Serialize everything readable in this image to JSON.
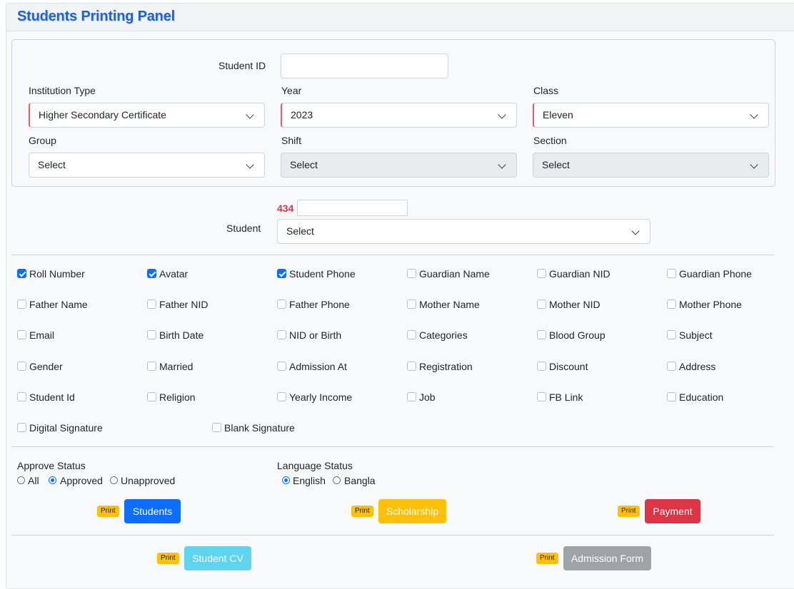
{
  "header": {
    "title": "Students Printing Panel"
  },
  "filters": {
    "student_id": {
      "label": "Student ID",
      "value": ""
    },
    "institution_type": {
      "label": "Institution Type",
      "value": "Higher Secondary Certificate"
    },
    "year": {
      "label": "Year",
      "value": "2023"
    },
    "class": {
      "label": "Class",
      "value": "Eleven"
    },
    "group": {
      "label": "Group",
      "value": "Select"
    },
    "shift": {
      "label": "Shift",
      "value": "Select"
    },
    "section": {
      "label": "Section",
      "value": "Select"
    }
  },
  "student": {
    "label": "Student",
    "count": "434",
    "search_value": "",
    "value": "Select"
  },
  "fields": [
    {
      "label": "Roll Number",
      "checked": true
    },
    {
      "label": "Avatar",
      "checked": true
    },
    {
      "label": "Student Phone",
      "checked": true
    },
    {
      "label": "Guardian Name",
      "checked": false
    },
    {
      "label": "Guardian NID",
      "checked": false
    },
    {
      "label": "Guardian Phone",
      "checked": false
    },
    {
      "label": "Father Name",
      "checked": false
    },
    {
      "label": "Father NID",
      "checked": false
    },
    {
      "label": "Father Phone",
      "checked": false
    },
    {
      "label": "Mother Name",
      "checked": false
    },
    {
      "label": "Mother NID",
      "checked": false
    },
    {
      "label": "Mother Phone",
      "checked": false
    },
    {
      "label": "Email",
      "checked": false
    },
    {
      "label": "Birth Date",
      "checked": false
    },
    {
      "label": "NID or Birth",
      "checked": false
    },
    {
      "label": "Categories",
      "checked": false
    },
    {
      "label": "Blood Group",
      "checked": false
    },
    {
      "label": "Subject",
      "checked": false
    },
    {
      "label": "Gender",
      "checked": false
    },
    {
      "label": "Married",
      "checked": false
    },
    {
      "label": "Admission At",
      "checked": false
    },
    {
      "label": "Registration",
      "checked": false
    },
    {
      "label": "Discount",
      "checked": false
    },
    {
      "label": "Address",
      "checked": false
    },
    {
      "label": "Student Id",
      "checked": false
    },
    {
      "label": "Religion",
      "checked": false
    },
    {
      "label": "Yearly Income",
      "checked": false
    },
    {
      "label": "Job",
      "checked": false
    },
    {
      "label": "FB Link",
      "checked": false
    },
    {
      "label": "Education",
      "checked": false
    },
    {
      "label": "Digital Signature",
      "checked": false
    },
    {
      "label": "Blank Signature",
      "checked": false
    }
  ],
  "approve_status": {
    "label": "Approve Status",
    "options": [
      {
        "label": "All",
        "selected": false
      },
      {
        "label": "Approved",
        "selected": true
      },
      {
        "label": "Unapproved",
        "selected": false
      }
    ]
  },
  "language_status": {
    "label": "Language Status",
    "options": [
      {
        "label": "English",
        "selected": true
      },
      {
        "label": "Bangla",
        "selected": false
      }
    ]
  },
  "print_badge": "Print",
  "buttons": {
    "students": {
      "label": "Students",
      "color": "#0d6efd"
    },
    "scholarship": {
      "label": "Scholarship",
      "color": "#ffc107"
    },
    "payment": {
      "label": "Payment",
      "color": "#dc3545"
    },
    "student_cv": {
      "label": "Student CV",
      "color": "#5fd4ee"
    },
    "admission_form": {
      "label": "Admission Form",
      "color": "#9fa3a7"
    }
  }
}
